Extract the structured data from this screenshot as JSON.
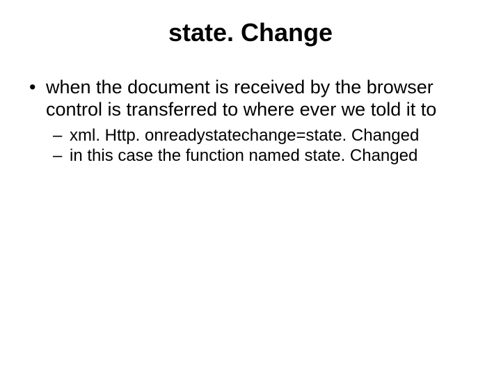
{
  "slide": {
    "title": "state. Change",
    "bullet1": "when the document is received by the browser control is transferred to where ever we told it to",
    "sub1": "xml. Http. onreadystatechange=state. Changed",
    "sub2": "in this case the function named state. Changed"
  }
}
